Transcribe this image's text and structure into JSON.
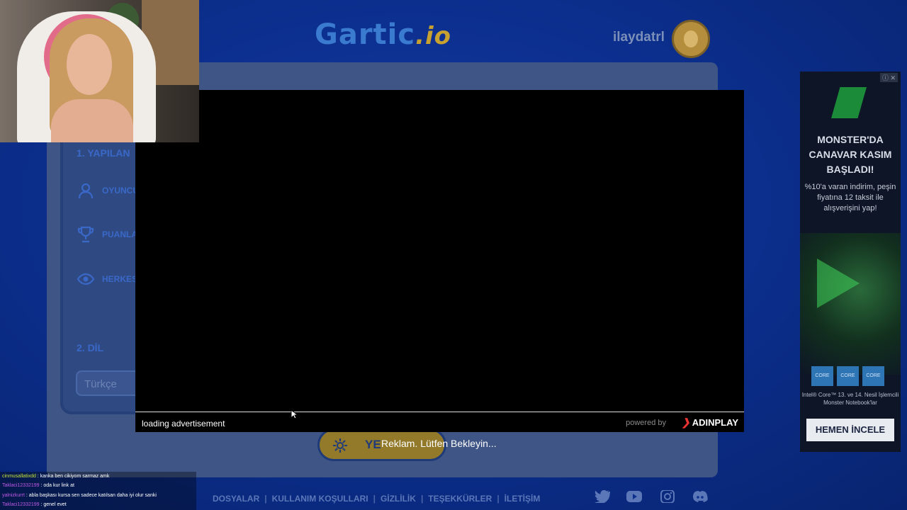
{
  "header": {
    "logo_main": "Gartic",
    "logo_suffix": ".io",
    "username": "ilaydatrl"
  },
  "settings": {
    "section1": "1. YAPILAN",
    "options": [
      "OYUNCU",
      "PUANLA",
      "HERKES"
    ],
    "section2": "2. DİL",
    "language_value": "Türkçe",
    "start_button_label": "YE"
  },
  "ad_overlay": {
    "status": "loading advertisement",
    "powered_by": "powered by",
    "brand": "ADINPLAY",
    "wait_message": "Reklam. Lütfen Bekleyin..."
  },
  "side_ad": {
    "badge": "ⓘ ✕",
    "headline": "MONSTER'DA CANAVAR KASIM BAŞLADI!",
    "body": "%10'a varan indirim, peşin fiyatına 12 taksit ile alışverişini yap!",
    "chips": [
      "CORE",
      "CORE",
      "CORE"
    ],
    "footnote": "Intel® Core™ 13. ve 14. Nesil İşlemcili Monster Notebook'lar",
    "cta": "HEMEN İNCELE"
  },
  "chat": [
    {
      "user": "cinmusallatixdd",
      "text": " : kanka ben cikiyom sarmaz amk"
    },
    {
      "user": "Taklaci12332199",
      "text": " : oda kur link at"
    },
    {
      "user": "yalnizkurrt",
      "text": " : abla başkası kursa sen sadece katılsan daha iyi olur sanki"
    },
    {
      "user": "Taklaci12332199",
      "text": " : genel evet"
    }
  ],
  "footer": {
    "links": [
      "DOSYALAR",
      "KULLANIM KOŞULLARI",
      "GİZLİLİK",
      "TEŞEKKÜRLER",
      "İLETİŞİM"
    ],
    "separator": "|",
    "social_icons": [
      "twitter-icon",
      "youtube-icon",
      "instagram-icon",
      "discord-icon"
    ]
  }
}
